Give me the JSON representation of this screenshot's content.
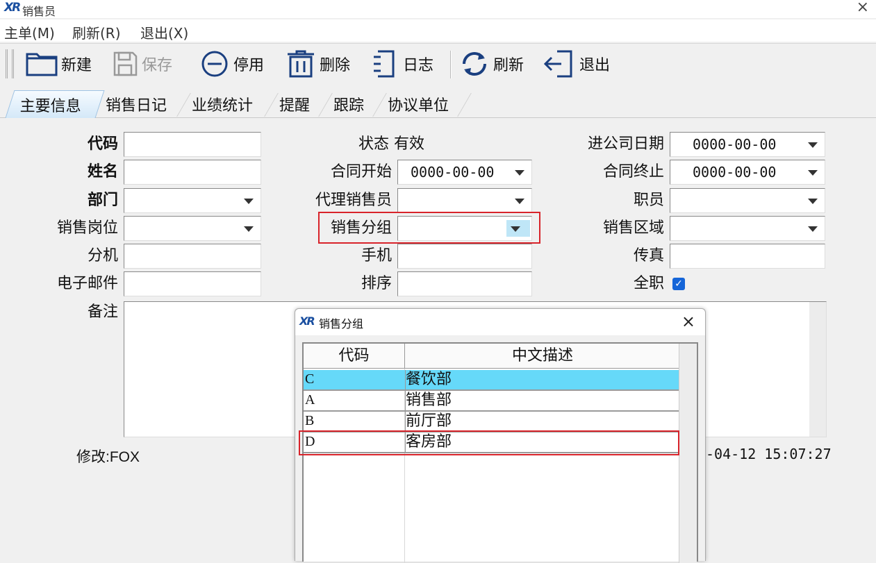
{
  "window": {
    "title": "销售员",
    "logo": "XR",
    "close": "×"
  },
  "menu": [
    "主单(M)",
    "刷新(R)",
    "退出(X)"
  ],
  "toolbar": {
    "new": "新建",
    "save": "保存",
    "disable": "停用",
    "delete": "删除",
    "log": "日志",
    "refresh": "刷新",
    "exit": "退出"
  },
  "tabs": [
    "主要信息",
    "销售日记",
    "业绩统计",
    "提醒",
    "跟踪",
    "协议单位"
  ],
  "form": {
    "code_label": "代码",
    "name_label": "姓名",
    "dept_label": "部门",
    "post_label": "销售岗位",
    "ext_label": "分机",
    "email_label": "电子邮件",
    "remark_label": "备注",
    "status_label": "状态",
    "status_value": "有效",
    "contract_start_label": "合同开始",
    "contract_start_value": "0000-00-00",
    "agent_label": "代理销售员",
    "group_label": "销售分组",
    "mobile_label": "手机",
    "order_label": "排序",
    "join_date_label": "进公司日期",
    "join_date_value": "0000-00-00",
    "contract_end_label": "合同终止",
    "contract_end_value": "0000-00-00",
    "staff_label": "职员",
    "region_label": "销售区域",
    "fax_label": "传真",
    "fulltime_label": "全职",
    "fulltime_checked": true,
    "modified_label": "修改:FOX",
    "modified_time": "-04-12 15:07:27"
  },
  "popup": {
    "title": "销售分组",
    "logo": "XR",
    "close": "×",
    "columns": [
      "代码",
      "中文描述"
    ],
    "rows": [
      {
        "code": "C",
        "desc": "餐饮部"
      },
      {
        "code": "A",
        "desc": "销售部"
      },
      {
        "code": "B",
        "desc": "前厅部"
      },
      {
        "code": "D",
        "desc": "客房部"
      }
    ],
    "selected_row": 0
  },
  "colors": {
    "selection": "#66d9f9",
    "highlight_box": "#d8232a",
    "accent": "#1565d8"
  }
}
